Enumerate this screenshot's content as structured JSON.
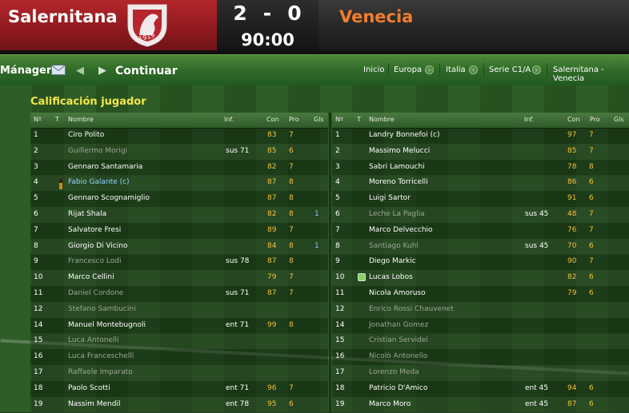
{
  "header": {
    "home_team": "Salernitana",
    "away_team": "Venecia",
    "home_score": "2",
    "separator": "-",
    "away_score": "0",
    "clock": "90:00",
    "crest_text": "1919",
    "home_color": "#a01f25",
    "away_color": "#f07e2a"
  },
  "nav": {
    "manager": "Mánager",
    "continue": "Continuar",
    "breadcrumbs": [
      "Inicio",
      "Europa",
      "Italia",
      "Serie C1/A",
      "Salernitana - Venecia"
    ]
  },
  "section_title": "Calificación jugador",
  "columns": [
    "Nº",
    "T",
    "Nombre",
    "Inf.",
    "Con",
    "Pro",
    "Gls"
  ],
  "home_players": [
    {
      "num": "1",
      "name": "Ciro Polito",
      "inf": "",
      "con": "83",
      "pro": "7",
      "gls": ""
    },
    {
      "num": "2",
      "name": "Guillermo Morigi",
      "inf": "sus 71",
      "con": "85",
      "pro": "6",
      "gls": ""
    },
    {
      "num": "3",
      "name": "Gennaro Santamaria",
      "inf": "",
      "con": "82",
      "pro": "7",
      "gls": ""
    },
    {
      "num": "4",
      "name": "Fabio Galante (c)",
      "inf": "",
      "con": "87",
      "pro": "8",
      "gls": ""
    },
    {
      "num": "5",
      "name": "Gennaro Scognamiglio",
      "inf": "",
      "con": "87",
      "pro": "8",
      "gls": ""
    },
    {
      "num": "6",
      "name": "Rijat Shala",
      "inf": "",
      "con": "82",
      "pro": "8",
      "gls": "1"
    },
    {
      "num": "7",
      "name": "Salvatore Fresi",
      "inf": "",
      "con": "89",
      "pro": "7",
      "gls": ""
    },
    {
      "num": "8",
      "name": "Giorgio Di Vicino",
      "inf": "",
      "con": "84",
      "pro": "8",
      "gls": "1"
    },
    {
      "num": "9",
      "name": "Francesco Lodi",
      "inf": "sus 78",
      "con": "87",
      "pro": "8",
      "gls": ""
    },
    {
      "num": "10",
      "name": "Marco Cellini",
      "inf": "",
      "con": "79",
      "pro": "7",
      "gls": ""
    },
    {
      "num": "11",
      "name": "Daniel Cordone",
      "inf": "sus 71",
      "con": "87",
      "pro": "7",
      "gls": ""
    },
    {
      "num": "12",
      "name": "Stefano Sambucini",
      "inf": "",
      "con": "",
      "pro": "",
      "gls": ""
    },
    {
      "num": "14",
      "name": "Manuel Montebugnoli",
      "inf": "ent 71",
      "con": "99",
      "pro": "8",
      "gls": ""
    },
    {
      "num": "15",
      "name": "Luca Antonelli",
      "inf": "",
      "con": "",
      "pro": "",
      "gls": ""
    },
    {
      "num": "16",
      "name": "Luca Franceschelli",
      "inf": "",
      "con": "",
      "pro": "",
      "gls": ""
    },
    {
      "num": "17",
      "name": "Raffaele Imparato",
      "inf": "",
      "con": "",
      "pro": "",
      "gls": ""
    },
    {
      "num": "18",
      "name": "Paolo Scotti",
      "inf": "ent 71",
      "con": "96",
      "pro": "7",
      "gls": ""
    },
    {
      "num": "19",
      "name": "Nassim Mendil",
      "inf": "ent 78",
      "con": "95",
      "pro": "6",
      "gls": ""
    }
  ],
  "away_players": [
    {
      "num": "1",
      "name": "Landry Bonnefoi (c)",
      "inf": "",
      "con": "97",
      "pro": "7",
      "gls": ""
    },
    {
      "num": "2",
      "name": "Massimo Melucci",
      "inf": "",
      "con": "85",
      "pro": "7",
      "gls": ""
    },
    {
      "num": "3",
      "name": "Sabri Lamouchi",
      "inf": "",
      "con": "78",
      "pro": "8",
      "gls": ""
    },
    {
      "num": "4",
      "name": "Moreno Torricelli",
      "inf": "",
      "con": "86",
      "pro": "6",
      "gls": ""
    },
    {
      "num": "5",
      "name": "Luigi Sartor",
      "inf": "",
      "con": "91",
      "pro": "6",
      "gls": ""
    },
    {
      "num": "6",
      "name": "Leche La Paglia",
      "inf": "sus 45",
      "con": "48",
      "pro": "7",
      "gls": ""
    },
    {
      "num": "7",
      "name": "Marco Delvecchio",
      "inf": "",
      "con": "76",
      "pro": "7",
      "gls": ""
    },
    {
      "num": "8",
      "name": "Santiago Kuhl",
      "inf": "sus 45",
      "con": "70",
      "pro": "6",
      "gls": ""
    },
    {
      "num": "9",
      "name": "Diego Markic",
      "inf": "",
      "con": "90",
      "pro": "7",
      "gls": ""
    },
    {
      "num": "10",
      "name": "Lucas Lobos",
      "inf": "",
      "con": "82",
      "pro": "6",
      "gls": ""
    },
    {
      "num": "11",
      "name": "Nicola Amoruso",
      "inf": "",
      "con": "79",
      "pro": "6",
      "gls": ""
    },
    {
      "num": "12",
      "name": "Enrico Rossi Chauvenet",
      "inf": "",
      "con": "",
      "pro": "",
      "gls": ""
    },
    {
      "num": "14",
      "name": "Jonathan Gomez",
      "inf": "",
      "con": "",
      "pro": "",
      "gls": ""
    },
    {
      "num": "15",
      "name": "Cristian Servidei",
      "inf": "",
      "con": "",
      "pro": "",
      "gls": ""
    },
    {
      "num": "16",
      "name": "Nicolò Antonello",
      "inf": "",
      "con": "",
      "pro": "",
      "gls": ""
    },
    {
      "num": "17",
      "name": "Lorenzo Meda",
      "inf": "",
      "con": "",
      "pro": "",
      "gls": ""
    },
    {
      "num": "18",
      "name": "Patricio D'Amico",
      "inf": "ent 45",
      "con": "94",
      "pro": "6",
      "gls": ""
    },
    {
      "num": "19",
      "name": "Marco Moro",
      "inf": "ent 45",
      "con": "87",
      "pro": "6",
      "gls": ""
    }
  ],
  "home_dimmed": [
    1,
    8,
    10,
    11,
    13,
    14,
    15
  ],
  "away_dimmed": [
    5,
    7,
    11,
    12,
    13,
    14,
    15
  ],
  "home_captain_index": 3,
  "home_booking_index": 3,
  "away_icon_index": 9,
  "icons": {
    "booking": "yellow-card-icon",
    "sub": "substitution-icon",
    "nav_mail": "envelope-icon",
    "nav_back": "arrow-left-icon",
    "nav_forward": "arrow-right-icon"
  }
}
